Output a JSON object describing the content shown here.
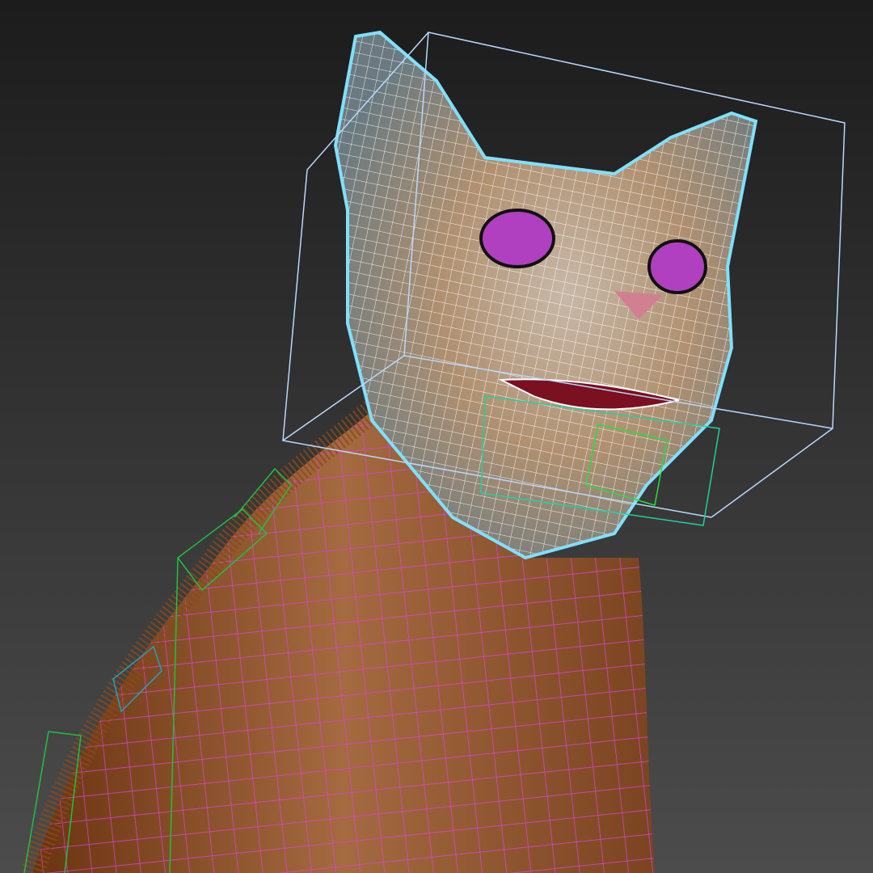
{
  "viewport": {
    "background_top": "#1c1c1c",
    "background_bottom": "#4c4c4c",
    "head_wire_color": "#ffffff",
    "head_outline_color": "#7fe0ff",
    "body_wire_color": "#e040e0",
    "fur_color": "#8a4a1c",
    "eye_color": "#b040c0",
    "bbox_head_color": "#b8d8ff",
    "bbox_jaw_color": "#20e080",
    "bbox_spine_color": "#20c040"
  }
}
